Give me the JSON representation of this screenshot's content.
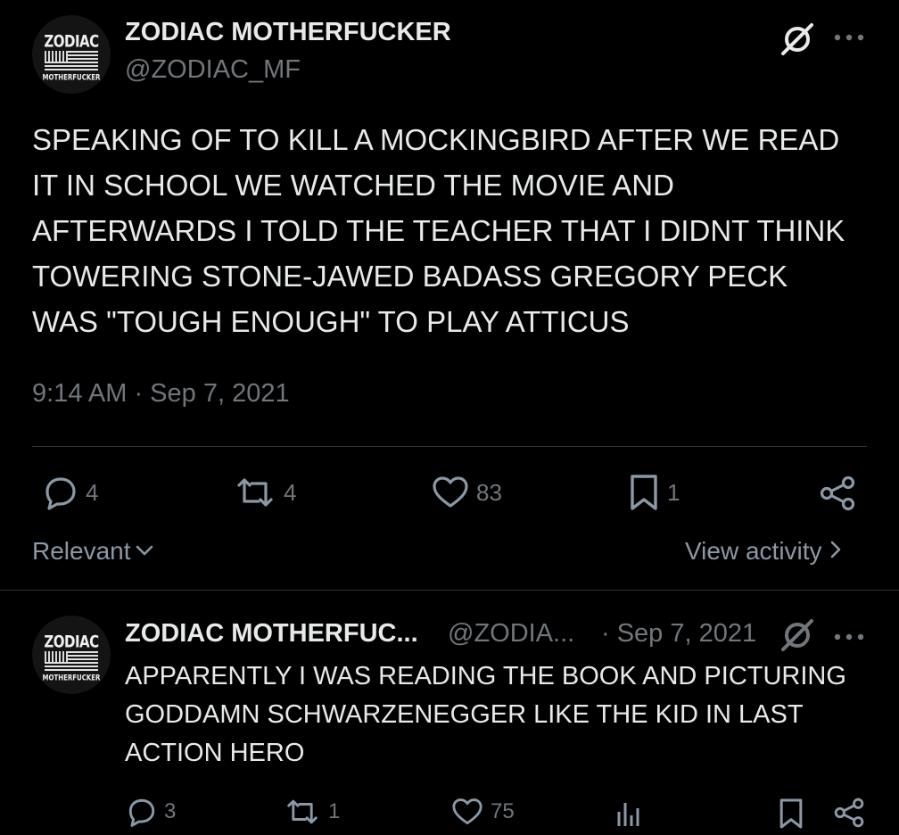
{
  "tweet": {
    "author_name": "ZODIAC MOTHERFUCKER",
    "author_handle": "@ZODIAC_MF",
    "avatar_text_top": "ZODIAC",
    "avatar_text_bottom": "MOTHERFUCKER",
    "body": "SPEAKING OF TO KILL A MOCKINGBIRD AFTER WE READ IT IN SCHOOL WE WATCHED THE MOVIE AND AFTERWARDS I TOLD THE TEACHER THAT I DIDNT THINK TOWERING STONE-JAWED BADASS GREGORY PECK WAS \"TOUGH ENOUGH\" TO PLAY ATTICUS",
    "timestamp": "9:14 AM · Sep 7, 2021",
    "stats": {
      "replies": "4",
      "reposts": "4",
      "likes": "83",
      "bookmarks": "1"
    }
  },
  "controls": {
    "sort_label": "Relevant",
    "view_activity_label": "View activity"
  },
  "reply": {
    "author_name": "ZODIAC MOTHERFUC...",
    "author_handle": "@ZODIA...",
    "date": "· Sep 7, 2021",
    "avatar_text_top": "ZODIAC",
    "avatar_text_bottom": "MOTHERFUCKER",
    "body": "APPARENTLY I WAS READING THE BOOK AND PICTURING GODDAMN SCHWARZENEGGER LIKE THE KID IN LAST ACTION HERO",
    "stats": {
      "replies": "3",
      "reposts": "1",
      "likes": "75"
    }
  },
  "icons": {
    "verified": "slashed-circle-icon",
    "more": "more-icon",
    "reply": "speech-bubble-icon",
    "repost": "repost-icon",
    "like": "heart-icon",
    "bookmark": "bookmark-icon",
    "share": "share-icon",
    "views": "bar-chart-icon"
  },
  "colors": {
    "background": "#000000",
    "text": "#e7e9ea",
    "muted": "#71767b",
    "divider": "#2f3336"
  }
}
